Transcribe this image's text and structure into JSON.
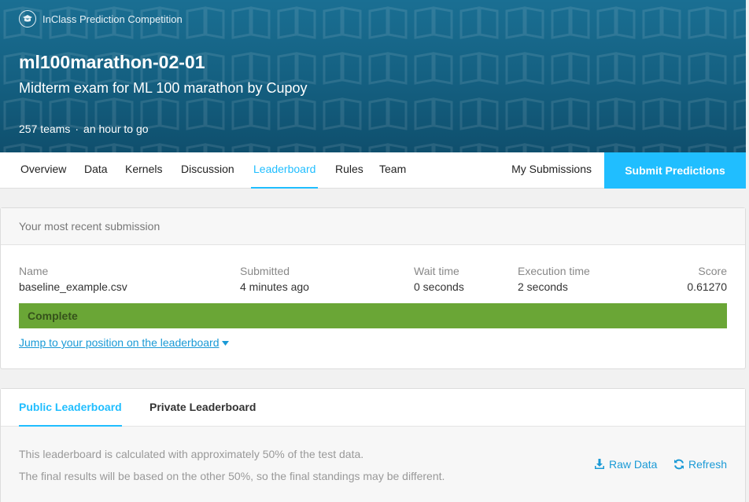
{
  "competition": {
    "tag": "InClass Prediction Competition",
    "title": "ml100marathon-02-01",
    "subtitle": "Midterm exam for ML 100 marathon by Cupoy",
    "teams": "257 teams",
    "time_left": "an hour to go"
  },
  "nav": {
    "tabs": [
      "Overview",
      "Data",
      "Kernels",
      "Discussion",
      "Leaderboard",
      "Rules",
      "Team"
    ],
    "active_tab": "Leaderboard",
    "my_submissions": "My Submissions",
    "submit": "Submit Predictions"
  },
  "submission": {
    "heading": "Your most recent submission",
    "labels": {
      "name": "Name",
      "submitted": "Submitted",
      "wait": "Wait time",
      "exec": "Execution time",
      "score": "Score"
    },
    "values": {
      "name": "baseline_example.csv",
      "submitted": "4 minutes ago",
      "wait": "0 seconds",
      "exec": "2 seconds",
      "score": "0.61270"
    },
    "status": "Complete",
    "jump_link": "Jump to your position on the leaderboard"
  },
  "leaderboard": {
    "tabs": [
      "Public Leaderboard",
      "Private Leaderboard"
    ],
    "active_tab": "Public Leaderboard",
    "note_1": "This leaderboard is calculated with approximately 50% of the test data.",
    "note_2": "The final results will be based on the other 50%, so the final standings may be different.",
    "raw_data": "Raw Data",
    "refresh": "Refresh"
  },
  "colors": {
    "accent": "#20beff",
    "header": "#145f80",
    "complete": "#6aa636",
    "link": "#1a9ad6"
  }
}
